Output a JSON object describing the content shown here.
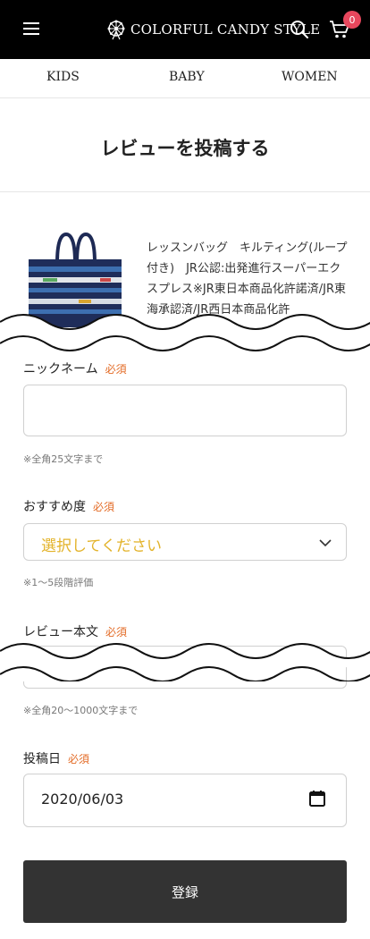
{
  "header": {
    "brand": "COLORFUL CANDY STYLE",
    "cart_count": "0"
  },
  "categories": [
    "KIDS",
    "BABY",
    "WOMEN"
  ],
  "page": {
    "title": "レビューを投稿する"
  },
  "product": {
    "name": "レッスンバッグ　キルティング(ループ付き)　JR公認:出発進行スーパーエクスプレス※JR東日本商品化許諾済/JR東海承認済/JR西日本商品化許"
  },
  "form": {
    "required_badge": "必須",
    "nickname": {
      "label": "ニックネーム",
      "hint": "※全角25文字まで"
    },
    "rating": {
      "label": "おすすめ度",
      "selected": "選択してください",
      "hint": "※1〜5段階評価"
    },
    "review": {
      "label": "レビュー本文",
      "hint": "※全角20〜1000文字まで"
    },
    "date": {
      "label": "投稿日",
      "value": "2020/06/03"
    },
    "submit_label": "登録"
  },
  "colors": {
    "required": "#e36b26",
    "select_text": "#e3b32a",
    "badge": "#e8475d",
    "button": "#333333"
  }
}
